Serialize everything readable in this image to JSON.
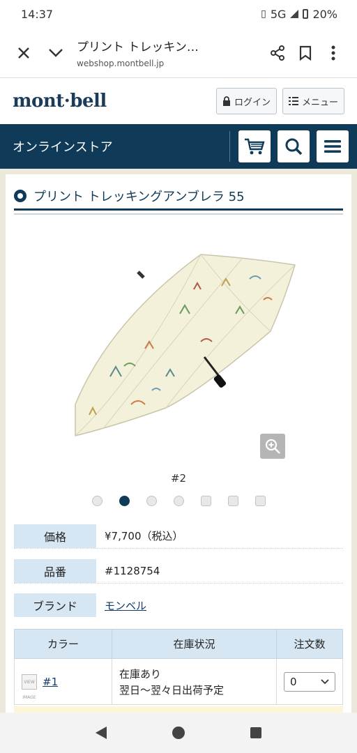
{
  "status": {
    "time": "14:37",
    "network": "5G",
    "battery": "20%"
  },
  "browser": {
    "title": "プリント トレッキン…",
    "host": "webshop.montbell.jp"
  },
  "header": {
    "logo": "mont·bell",
    "login": "ログイン",
    "menu": "メニュー"
  },
  "store": {
    "title": "オンラインストア"
  },
  "product": {
    "title": "プリント トレッキングアンブレラ 55",
    "image_caption": "#2",
    "carousel": {
      "count": 7,
      "active_index": 1
    }
  },
  "specs": [
    {
      "label": "価格",
      "value": "¥7,700（税込）"
    },
    {
      "label": "品番",
      "value": "#1128754"
    },
    {
      "label": "ブランド",
      "value": "モンベル"
    }
  ],
  "stock_table": {
    "headers": [
      "カラー",
      "在庫状況",
      "注文数"
    ],
    "rows": [
      {
        "swatch_text": "VIEW IMAGE",
        "color": "#1",
        "status_line1": "在庫あり",
        "status_line2": "翌日～翌々日出荷予定",
        "qty": "0"
      }
    ]
  },
  "colors": {
    "navy": "#0f3a58",
    "label_bg": "#d6e6f2",
    "page_bg": "#ece8dc",
    "canopy": "#f4f1db"
  }
}
